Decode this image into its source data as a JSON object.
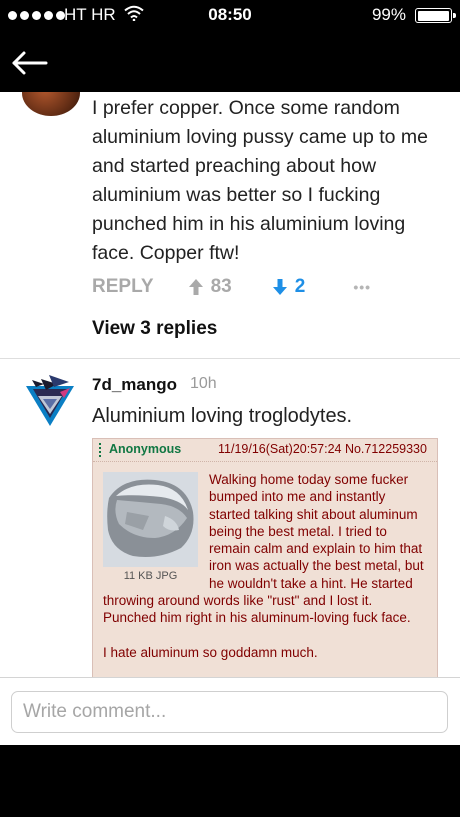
{
  "status_bar": {
    "carrier": "HT HR",
    "time": "08:50",
    "battery": "99%"
  },
  "comment1": {
    "text": "I prefer copper. Once some random aluminium loving pussy came up to me and started preaching about how aluminium was better so I fucking punched him in his aluminium loving face. Copper ftw!",
    "reply_label": "REPLY",
    "upvotes": "83",
    "downvotes": "2",
    "more": "•••",
    "view_replies": "View 3 replies"
  },
  "comment2": {
    "username": "7d_mango",
    "time_ago": "10h",
    "text": "Aluminium loving troglodytes.",
    "post": {
      "name": "Anonymous",
      "date": "11/19/16(Sat)20:57:24 No.712259330",
      "file_info": "11 KB JPG",
      "body_p1": "Walking home today some fucker bumped into me and instantly started talking shit about aluminum being the best metal. I tried to remain calm and explain to him that iron was actually the best metal, but he wouldn't take a hint. He started throwing around words like \"rust\" and I lost it. Punched him right in his aluminum-loving fuck face.",
      "body_p2": "I hate aluminum so goddamn much."
    }
  },
  "composer": {
    "placeholder": "Write comment..."
  },
  "colors": {
    "accent_blue": "#1e8fe6",
    "greentext_name": "#117743",
    "post_text": "#800000",
    "post_bg": "#f0e0d6"
  },
  "icons": {
    "back": "back-arrow-icon",
    "upvote": "arrow-up-icon",
    "downvote": "arrow-down-icon",
    "wifi": "wifi-icon",
    "battery": "battery-icon"
  }
}
